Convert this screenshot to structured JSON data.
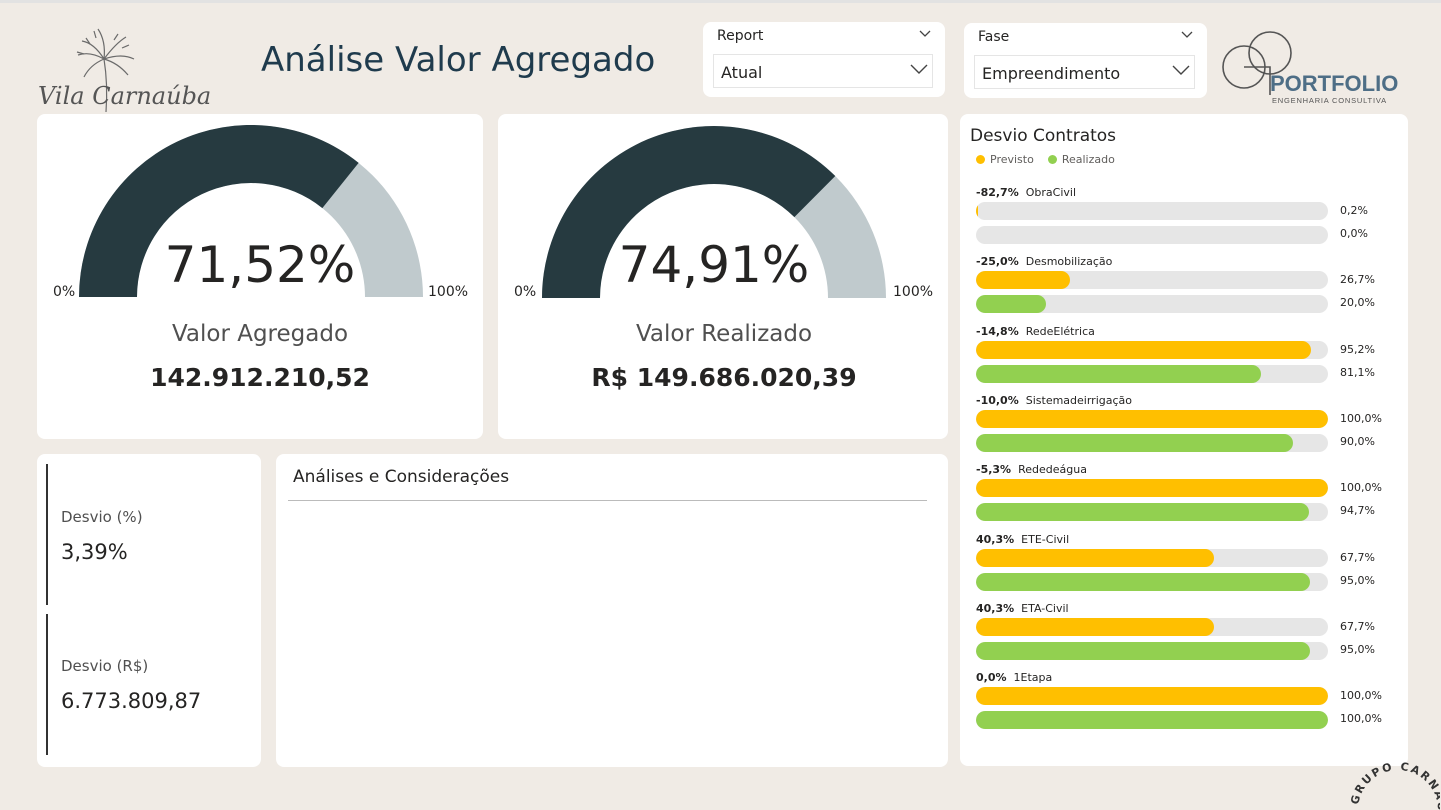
{
  "header": {
    "title": "Análise Valor Agregado",
    "logo_left_text": "Vila Carnaúba",
    "logo_right_name": "PORTFOLIO",
    "logo_right_sub": "ENGENHARIA CONSULTIVA"
  },
  "slicers": [
    {
      "label": "Report",
      "value": "Atual"
    },
    {
      "label": "Fase",
      "value": "Empreendimento"
    }
  ],
  "gauges": [
    {
      "percent_text": "71,52%",
      "percent": 71.52,
      "min": "0%",
      "max": "100%",
      "label": "Valor Agregado",
      "value": "142.912.210,52"
    },
    {
      "percent_text": "74,91%",
      "percent": 74.91,
      "min": "0%",
      "max": "100%",
      "label": "Valor Realizado",
      "value": "R$ 149.686.020,39"
    }
  ],
  "kpis": [
    {
      "label": "Desvio (%)",
      "value": "3,39%"
    },
    {
      "label": "Desvio (R$)",
      "value": "6.773.809,87"
    }
  ],
  "analysis": {
    "title": "Análises e Considerações"
  },
  "desvio_contratos": {
    "title": "Desvio Contratos",
    "legend": [
      {
        "name": "Previsto",
        "color": "#ffbf00"
      },
      {
        "name": "Realizado",
        "color": "#92d050"
      }
    ],
    "items": [
      {
        "desvio": "-82,7%",
        "name": "ObraCivil",
        "previsto": 0.2,
        "previsto_text": "0,2%",
        "realizado": 0.0,
        "realizado_text": "0,0%"
      },
      {
        "desvio": "-25,0%",
        "name": "Desmobilização",
        "previsto": 26.7,
        "previsto_text": "26,7%",
        "realizado": 20.0,
        "realizado_text": "20,0%"
      },
      {
        "desvio": "-14,8%",
        "name": "RedeElétrica",
        "previsto": 95.2,
        "previsto_text": "95,2%",
        "realizado": 81.1,
        "realizado_text": "81,1%"
      },
      {
        "desvio": "-10,0%",
        "name": "Sistemadeirrigação",
        "previsto": 100.0,
        "previsto_text": "100,0%",
        "realizado": 90.0,
        "realizado_text": "90,0%"
      },
      {
        "desvio": "-5,3%",
        "name": "Rededeágua",
        "previsto": 100.0,
        "previsto_text": "100,0%",
        "realizado": 94.7,
        "realizado_text": "94,7%"
      },
      {
        "desvio": "40,3%",
        "name": "ETE-Civil",
        "previsto": 67.7,
        "previsto_text": "67,7%",
        "realizado": 95.0,
        "realizado_text": "95,0%"
      },
      {
        "desvio": "40,3%",
        "name": "ETA-Civil",
        "previsto": 67.7,
        "previsto_text": "67,7%",
        "realizado": 95.0,
        "realizado_text": "95,0%"
      },
      {
        "desvio": "0,0%",
        "name": "1Etapa",
        "previsto": 100.0,
        "previsto_text": "100,0%",
        "realizado": 100.0,
        "realizado_text": "100,0%"
      }
    ]
  },
  "badge": {
    "text": "GRUPO CARNAÚBA"
  },
  "colors": {
    "gauge_fill": "#263a40",
    "gauge_rest": "#c0cacd",
    "title": "#1f3b4d"
  }
}
